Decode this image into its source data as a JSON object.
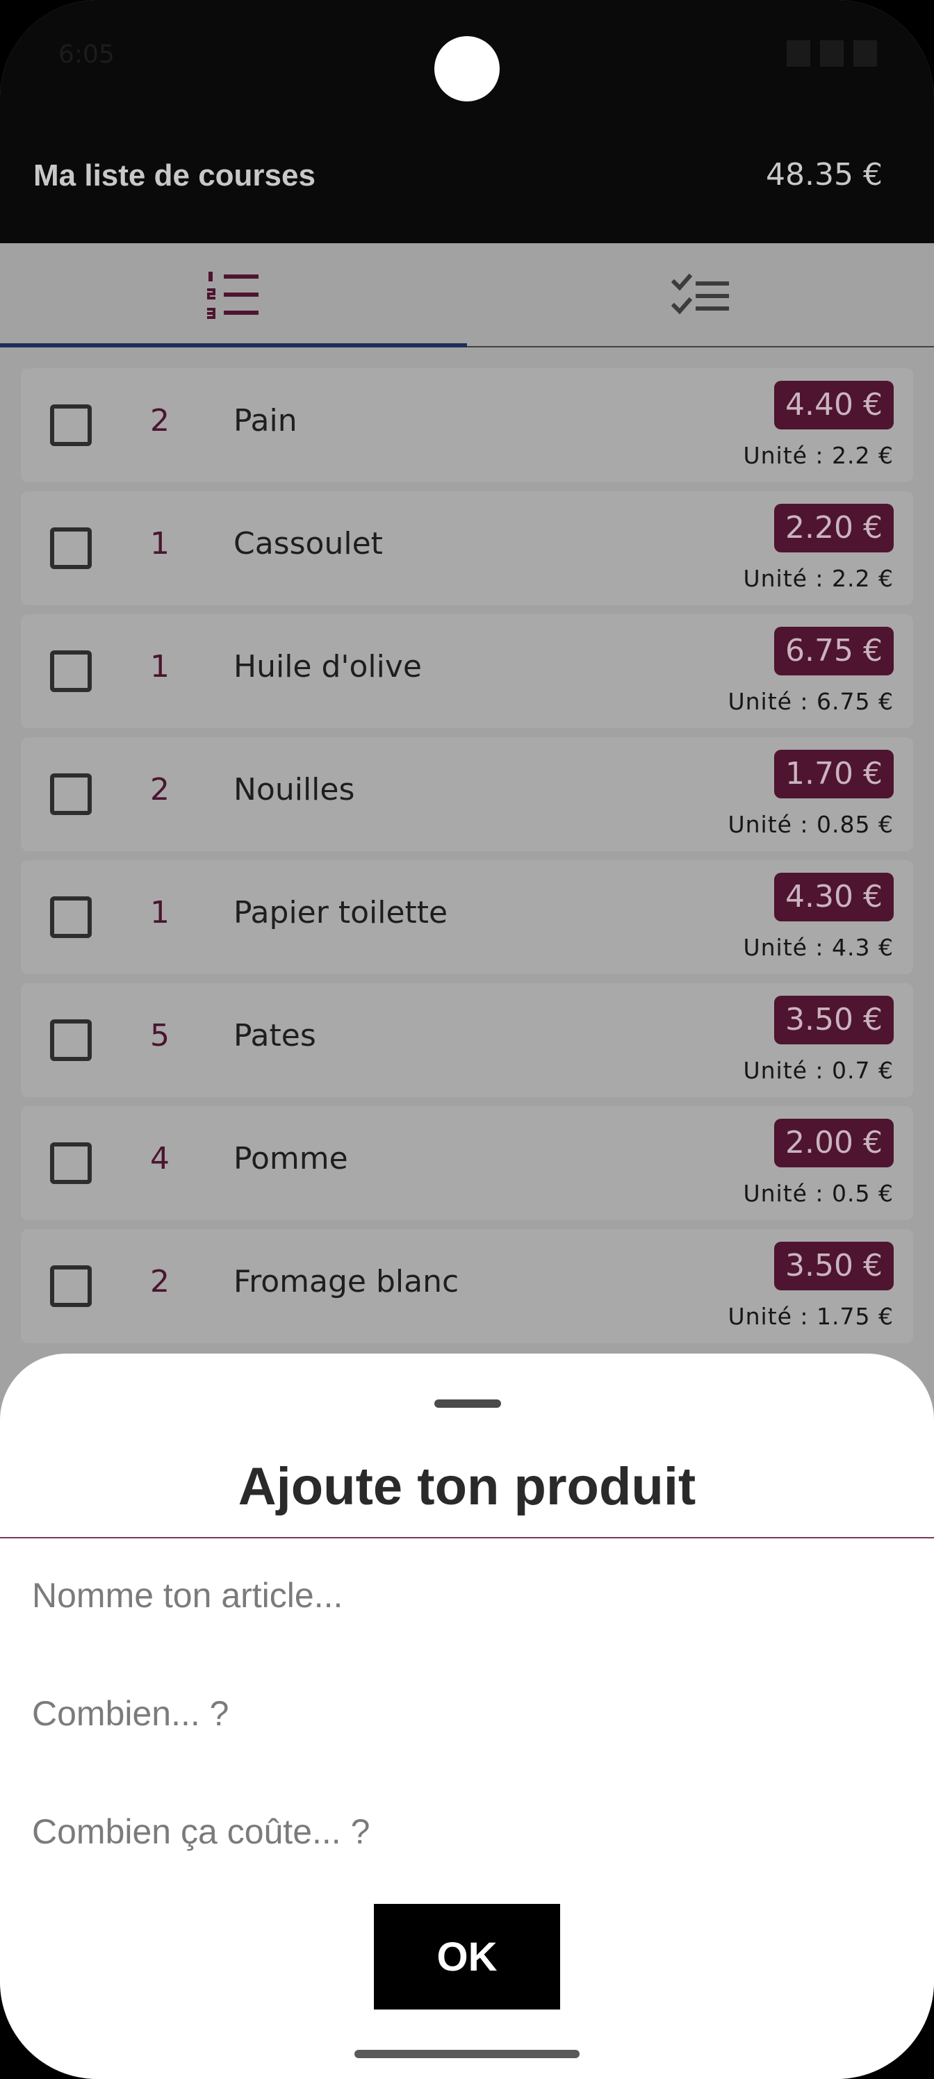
{
  "status_bar": {
    "time": "6:05"
  },
  "app_bar": {
    "title": "Ma liste de courses",
    "total": "48.35 €"
  },
  "tabs": [
    {
      "icon": "numbered-list-icon",
      "active": true
    },
    {
      "icon": "checklist-icon",
      "active": false
    }
  ],
  "items": [
    {
      "qty": "2",
      "name": "Pain",
      "price": "4.40 €",
      "unit": "Unité : 2.2 €"
    },
    {
      "qty": "1",
      "name": "Cassoulet",
      "price": "2.20 €",
      "unit": "Unité : 2.2 €"
    },
    {
      "qty": "1",
      "name": "Huile d'olive",
      "price": "6.75 €",
      "unit": "Unité : 6.75 €"
    },
    {
      "qty": "2",
      "name": "Nouilles",
      "price": "1.70 €",
      "unit": "Unité : 0.85 €"
    },
    {
      "qty": "1",
      "name": "Papier toilette",
      "price": "4.30 €",
      "unit": "Unité : 4.3 €"
    },
    {
      "qty": "5",
      "name": "Pates",
      "price": "3.50 €",
      "unit": "Unité : 0.7 €"
    },
    {
      "qty": "4",
      "name": "Pomme",
      "price": "2.00 €",
      "unit": "Unité : 0.5 €"
    },
    {
      "qty": "2",
      "name": "Fromage blanc",
      "price": "3.50 €",
      "unit": "Unité : 1.75 €"
    }
  ],
  "sheet": {
    "title": "Ajoute ton produit",
    "name_placeholder": "Nomme ton article...",
    "qty_placeholder": "Combien... ?",
    "price_placeholder": "Combien ça coûte... ?",
    "ok_label": "OK"
  },
  "colors": {
    "accent": "#4e1430",
    "tab_indicator": "#1d2f5a",
    "scrim_background": "#a2a2a2"
  }
}
